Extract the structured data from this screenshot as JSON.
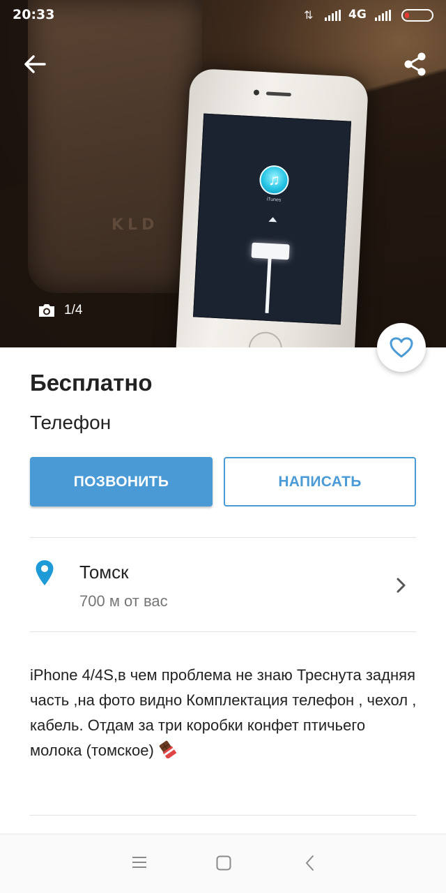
{
  "status_bar": {
    "time": "20:33",
    "network": "4G"
  },
  "photo": {
    "counter": "1/4",
    "case_brand": "KLD",
    "screen_app_label": "iTunes"
  },
  "listing": {
    "price": "Бесплатно",
    "title": "Телефон"
  },
  "actions": {
    "call_label": "ПОЗВОНИТЬ",
    "write_label": "НАПИСАТЬ",
    "accent_color": "#4a9ad6"
  },
  "location": {
    "city": "Томск",
    "distance": "700 м от вас",
    "pin_color": "#1e9ad6"
  },
  "description": {
    "text": "iPhone 4/4S,в чем проблема не знаю Треснута задняя часть ,на фото видно Комплектация телефон , чехол , кабель. Отдам за три коробки конфет птичьего молока (томское)"
  },
  "icons": {
    "back": "arrow-left-icon",
    "share": "share-icon",
    "camera": "camera-icon",
    "favorite": "heart-outline-icon",
    "location": "map-pin-icon",
    "chevron": "chevron-right-icon",
    "emoji": "chocolate-bar-emoji",
    "nav_menu": "menu-icon",
    "nav_home": "square-home-icon",
    "nav_back": "triangle-back-icon"
  }
}
